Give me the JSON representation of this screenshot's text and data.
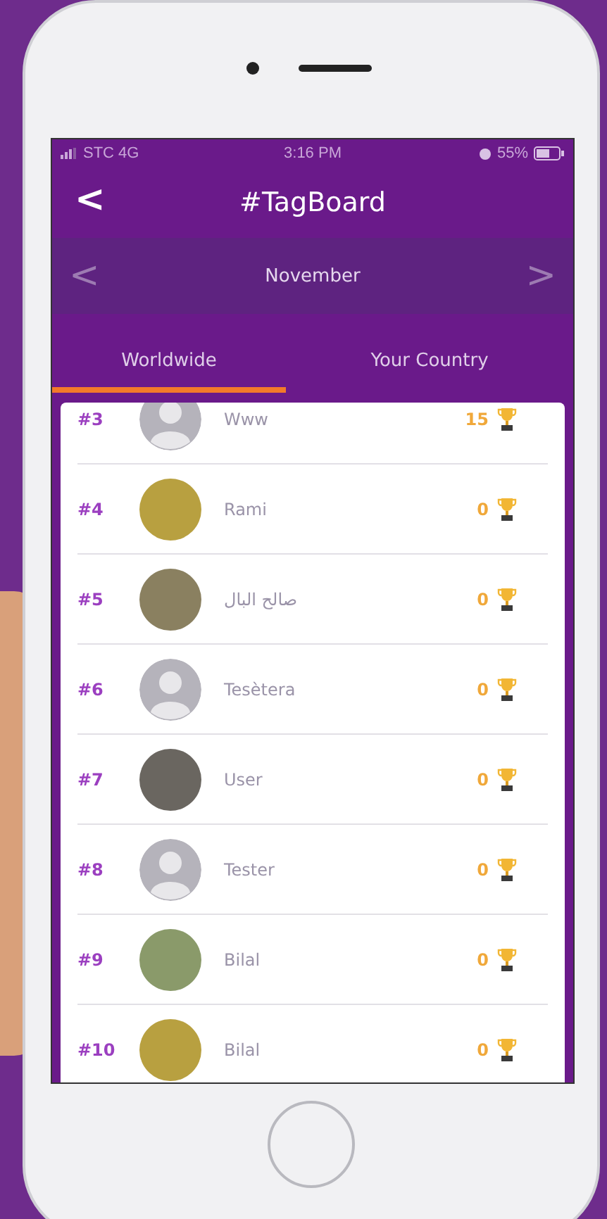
{
  "status_bar": {
    "carrier": "STC  4G",
    "time": "3:16 PM",
    "battery": "55%"
  },
  "header": {
    "back": "<",
    "title": "#TagBoard"
  },
  "month_bar": {
    "prev": "<",
    "label": "November",
    "next": ">"
  },
  "tabs": [
    {
      "label": "Worldwide",
      "selected": true
    },
    {
      "label": "Your Country",
      "selected": false
    }
  ],
  "rows": [
    {
      "rank": "#3",
      "name": "Www",
      "score": "15",
      "kind": "default"
    },
    {
      "rank": "#4",
      "name": "Rami",
      "score": "0",
      "kind": "photo"
    },
    {
      "rank": "#5",
      "name": "صالح البال",
      "score": "0",
      "kind": "photo"
    },
    {
      "rank": "#6",
      "name": "Tesètera",
      "score": "0",
      "kind": "default"
    },
    {
      "rank": "#7",
      "name": "User",
      "score": "0",
      "kind": "photo"
    },
    {
      "rank": "#8",
      "name": "Tester",
      "score": "0",
      "kind": "default"
    },
    {
      "rank": "#9",
      "name": "Bilal",
      "score": "0",
      "kind": "photo"
    },
    {
      "rank": "#10",
      "name": "Bilal",
      "score": "0",
      "kind": "photo"
    }
  ]
}
